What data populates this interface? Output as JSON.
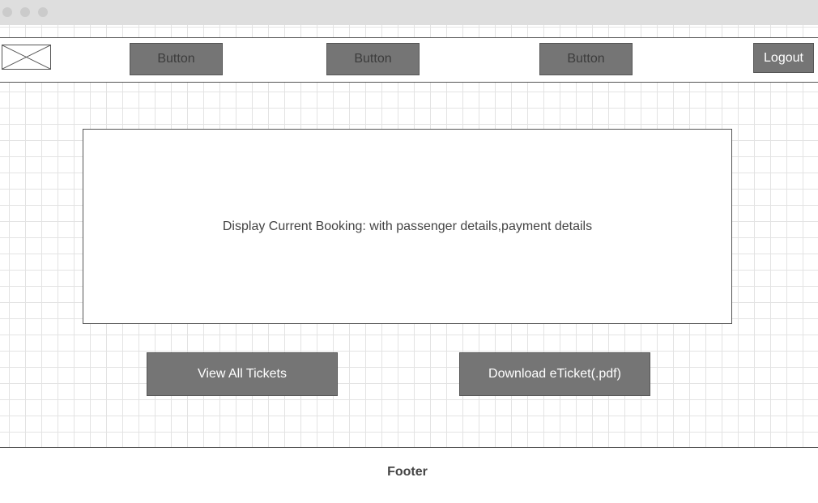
{
  "nav": {
    "buttons": [
      "Button",
      "Button",
      "Button"
    ],
    "logout_label": "Logout"
  },
  "main": {
    "booking_text": "Display Current Booking: with passenger details,payment details",
    "view_all_label": "View All Tickets",
    "download_label": "Download eTicket(.pdf)"
  },
  "footer": {
    "label": "Footer"
  },
  "icons": {
    "logo": "image-placeholder-icon"
  },
  "colors": {
    "button_fill": "#757575",
    "border": "#555555",
    "titlebar": "#dedede"
  }
}
